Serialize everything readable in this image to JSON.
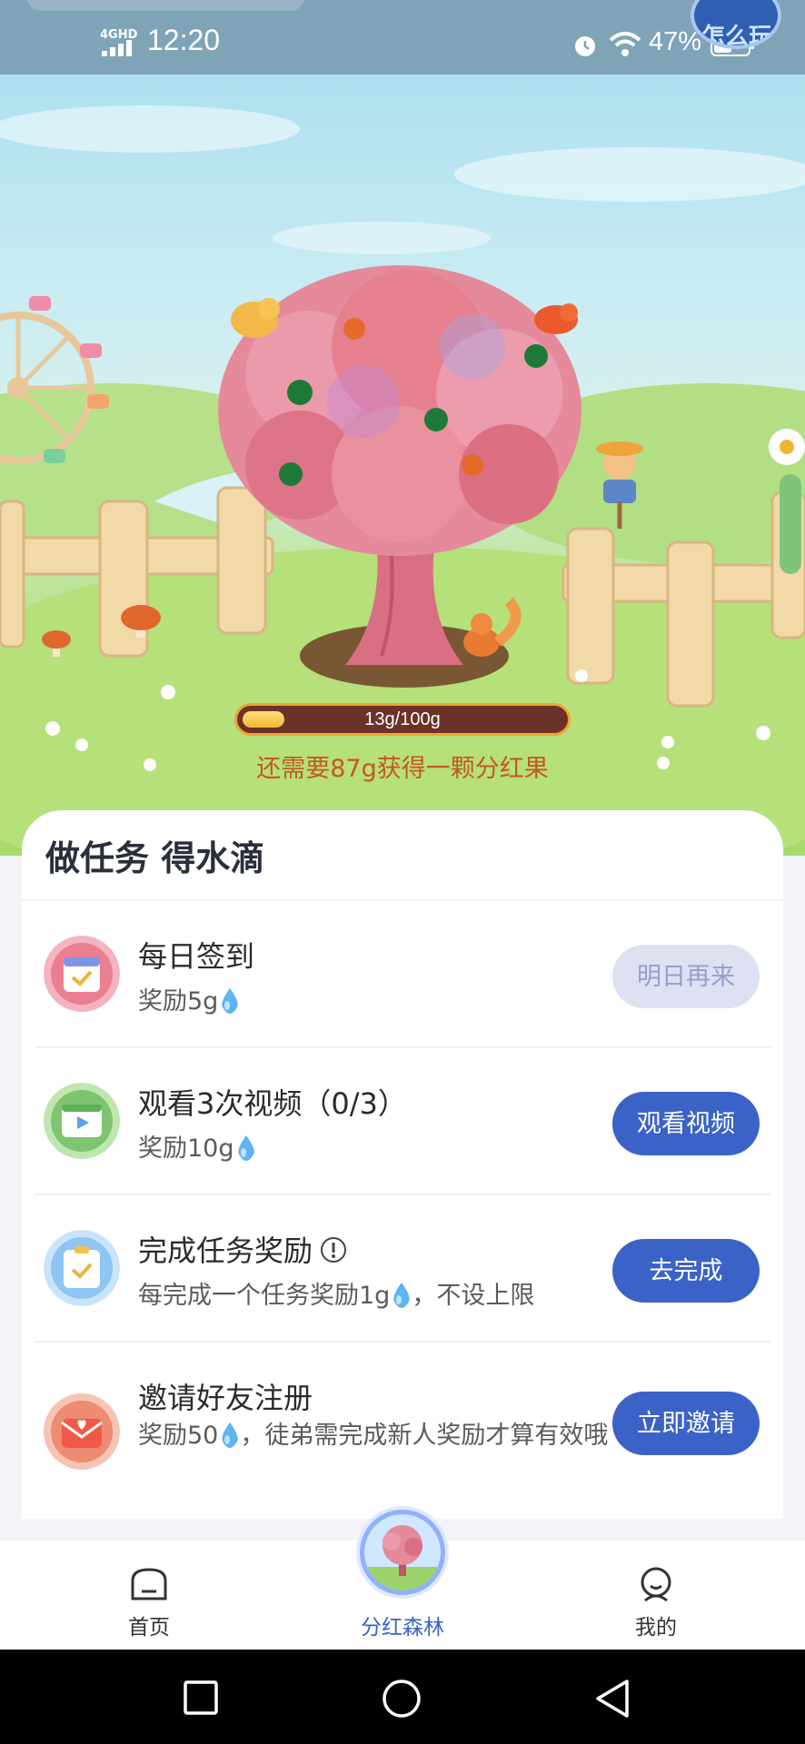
{
  "status_bar": {
    "network": "4GHD",
    "time": "12:20",
    "battery": "47%",
    "corner_logo_text": "怎么玩"
  },
  "tree": {
    "progress_label": "13g/100g",
    "progress_fraction": 0.13,
    "hint": "还需要87g获得一颗分红果"
  },
  "tasks_card": {
    "title": "做任务 得水滴",
    "tasks": [
      {
        "name": "每日签到",
        "desc": "奖励5g",
        "desc_suffix": "",
        "button": "明日再来",
        "icon": "calendar-icon",
        "enabled": false
      },
      {
        "name": "观看3次视频（0/3）",
        "desc": "奖励10g",
        "desc_suffix": "",
        "button": "观看视频",
        "icon": "video-icon",
        "enabled": true
      },
      {
        "name": "完成任务奖励",
        "desc": "每完成一个任务奖励1g",
        "desc_suffix": "，不设上限",
        "button": "去完成",
        "icon": "clipboard-icon",
        "enabled": true
      },
      {
        "name": "邀请好友注册",
        "desc": "奖励50",
        "desc_suffix": "，徒弟需完成新人奖励才算有效哦",
        "button": "立即邀请",
        "icon": "envelope-icon",
        "enabled": true
      }
    ]
  },
  "bottom_nav": {
    "home": "首页",
    "forest": "分红森林",
    "mine": "我的"
  },
  "colors": {
    "primary_button": "#3b63c7",
    "disabled_button": "#dde1f2",
    "hint_text": "#c5591c",
    "progress_fill": "#f3b533"
  }
}
